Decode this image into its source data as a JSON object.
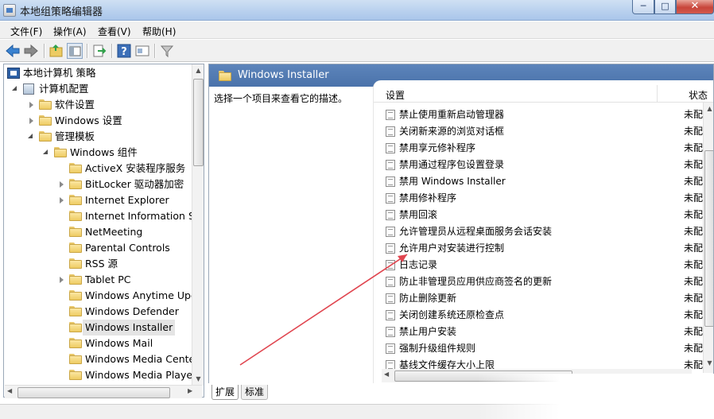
{
  "window": {
    "title": "本地组策略编辑器",
    "controls": {
      "minimize": "─",
      "maximize": "□",
      "close": "✕"
    }
  },
  "menu": [
    "文件(F)",
    "操作(A)",
    "查看(V)",
    "帮助(H)"
  ],
  "toolbar": {
    "icons": [
      "back-arrow-icon",
      "forward-arrow-icon",
      "up-folder-icon",
      "show-hide-tree-icon",
      "export-list-icon",
      "help-icon",
      "properties-icon",
      "filter-icon"
    ]
  },
  "tree": {
    "items": [
      {
        "label": "本地计算机 策略",
        "level": 0,
        "icon": "policy-icon",
        "expander": "none"
      },
      {
        "label": "计算机配置",
        "level": 1,
        "icon": "computer-icon",
        "expander": "expanded"
      },
      {
        "label": "软件设置",
        "level": 2,
        "icon": "folder-icon",
        "expander": "collapsed"
      },
      {
        "label": "Windows 设置",
        "level": 2,
        "icon": "folder-icon",
        "expander": "collapsed"
      },
      {
        "label": "管理模板",
        "level": 2,
        "icon": "folder-icon",
        "expander": "expanded"
      },
      {
        "label": "Windows 组件",
        "level": 3,
        "icon": "folder-icon",
        "expander": "expanded"
      },
      {
        "label": "ActiveX 安装程序服务",
        "level": 4,
        "icon": "folder-icon",
        "expander": "none"
      },
      {
        "label": "BitLocker 驱动器加密",
        "level": 4,
        "icon": "folder-icon",
        "expander": "collapsed"
      },
      {
        "label": "Internet Explorer",
        "level": 4,
        "icon": "folder-icon",
        "expander": "collapsed"
      },
      {
        "label": "Internet Information Se",
        "level": 4,
        "icon": "folder-icon",
        "expander": "none"
      },
      {
        "label": "NetMeeting",
        "level": 4,
        "icon": "folder-icon",
        "expander": "none"
      },
      {
        "label": "Parental Controls",
        "level": 4,
        "icon": "folder-icon",
        "expander": "none"
      },
      {
        "label": "RSS 源",
        "level": 4,
        "icon": "folder-icon",
        "expander": "none"
      },
      {
        "label": "Tablet PC",
        "level": 4,
        "icon": "folder-icon",
        "expander": "collapsed"
      },
      {
        "label": "Windows Anytime Upgı",
        "level": 4,
        "icon": "folder-icon",
        "expander": "none"
      },
      {
        "label": "Windows Defender",
        "level": 4,
        "icon": "folder-icon",
        "expander": "none"
      },
      {
        "label": "Windows Installer",
        "level": 4,
        "icon": "folder-icon",
        "expander": "none",
        "selected": true
      },
      {
        "label": "Windows Mail",
        "level": 4,
        "icon": "folder-icon",
        "expander": "none"
      },
      {
        "label": "Windows Media Center",
        "level": 4,
        "icon": "folder-icon",
        "expander": "none"
      },
      {
        "label": "Windows Media Player",
        "level": 4,
        "icon": "folder-icon",
        "expander": "none"
      }
    ]
  },
  "details": {
    "header": "Windows Installer",
    "description": "选择一个项目来查看它的描述。",
    "columns": {
      "setting": "设置",
      "state": "状态"
    },
    "rows": [
      {
        "name": "禁止使用重新启动管理器",
        "state": "未配置"
      },
      {
        "name": "关闭新来源的浏览对话框",
        "state": "未配置"
      },
      {
        "name": "禁用享元修补程序",
        "state": "未配置"
      },
      {
        "name": "禁用通过程序包设置登录",
        "state": "未配置"
      },
      {
        "name": "禁用 Windows Installer",
        "state": "未配置"
      },
      {
        "name": "禁用修补程序",
        "state": "未配置"
      },
      {
        "name": "禁用回滚",
        "state": "未配置"
      },
      {
        "name": "允许管理员从远程桌面服务会话安装",
        "state": "未配置"
      },
      {
        "name": "允许用户对安装进行控制",
        "state": "未配置"
      },
      {
        "name": "日志记录",
        "state": "未配置"
      },
      {
        "name": "防止非管理员应用供应商签名的更新",
        "state": "未配置"
      },
      {
        "name": "防止删除更新",
        "state": "未配置"
      },
      {
        "name": "关闭创建系统还原检查点",
        "state": "未配置"
      },
      {
        "name": "禁止用户安装",
        "state": "未配置"
      },
      {
        "name": "强制升级组件规则",
        "state": "未配置"
      },
      {
        "name": "基线文件缓存大小上限",
        "state": "未配置"
      }
    ]
  },
  "tabs": [
    "扩展",
    "标准"
  ],
  "colors": {
    "title_bar": "#b9d1ee",
    "header_blue": "#4f77ad",
    "annotation_arrow": "#e0454f"
  }
}
